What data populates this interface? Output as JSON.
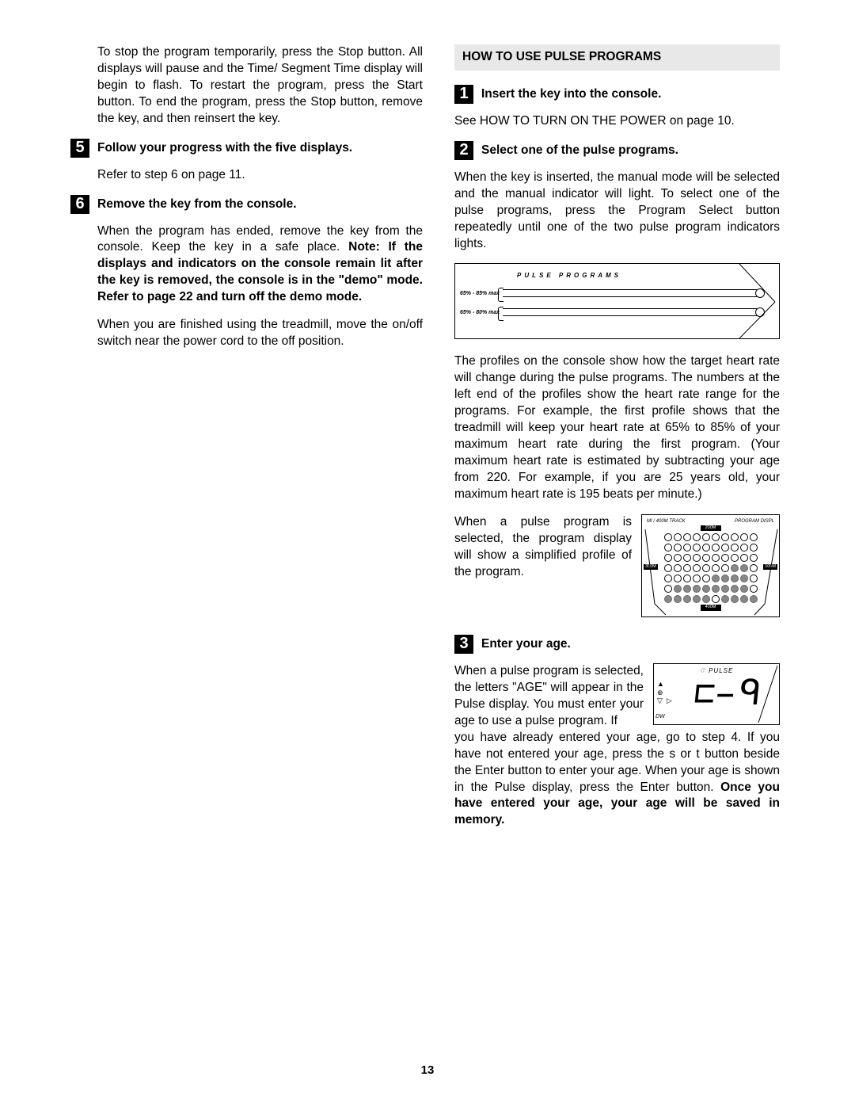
{
  "left": {
    "intro": "To stop the program temporarily, press the Stop button. All displays will pause and the Time/ Segment Time display will begin to flash. To restart the program, press the Start button. To end the program, press the Stop button, remove the key, and then reinsert the key.",
    "step5": {
      "num": "5",
      "title": "Follow your progress with the five displays.",
      "body": "Refer to step 6 on page 11."
    },
    "step6": {
      "num": "6",
      "title": "Remove the key from the console.",
      "body1": "When the program has ended, remove the key from the console. Keep the key in a safe place. ",
      "note": "Note: If the displays and indicators on the console remain lit after the key is removed, the console is in the \"demo\" mode. Refer to page 22 and turn off the demo mode.",
      "body2": "When you are finished using the treadmill, move the on/off switch near the power cord to the off position."
    }
  },
  "right": {
    "header": "HOW TO USE PULSE PROGRAMS",
    "step1": {
      "num": "1",
      "title": "Insert the key into the console.",
      "body": "See HOW TO TURN ON THE POWER on page 10."
    },
    "step2": {
      "num": "2",
      "title": "Select one of the pulse programs.",
      "body1": "When the key is inserted, the manual mode will be selected and the manual indicator will light. To select one of the pulse programs, press the Program Select button repeatedly until one of the two pulse program indicators lights.",
      "diagram": {
        "header": "PULSE PROGRAMS",
        "row1": "65% - 85% max",
        "row2": "65% - 80% max"
      },
      "body2": "The profiles on the console show how the target heart rate will change during the pulse programs. The numbers at the left end of the profiles show the heart rate range for the programs. For example, the first profile shows that the treadmill will keep your heart rate at 65% to 85% of your maximum heart rate during the first program. (Your maximum heart rate is estimated by subtracting your age from 220. For example, if you are 25 years old, your maximum heart rate is 195 beats per minute.)",
      "body3": "When a pulse program is selected, the program display will show a simplified profile of the program.",
      "track": {
        "hdr_left": "MI / 400M TRACK",
        "hdr_right": "PROGRAM DISPL",
        "top": "200M",
        "left": "300M",
        "right": "100M",
        "bottom": "400M"
      }
    },
    "step3": {
      "num": "3",
      "title": "Enter your age.",
      "body1": "When a pulse program is selected, the letters \"AGE\" will appear in the Pulse display. You must enter your age to use a pulse program. If",
      "age_display": {
        "label": "PULSE",
        "value": "29",
        "dw": "DW"
      },
      "body2_a": "you have already entered your age, go to step 4. If you have not entered your age, press the ",
      "sym1": "s",
      "mid": " or ",
      "sym2": "t",
      "body2_b": " button beside the Enter button to enter your age. When your age is shown in the Pulse display, press the Enter button. ",
      "body2_bold": "Once you have entered your age, your age will be saved in memory."
    }
  },
  "pagenum": "13"
}
